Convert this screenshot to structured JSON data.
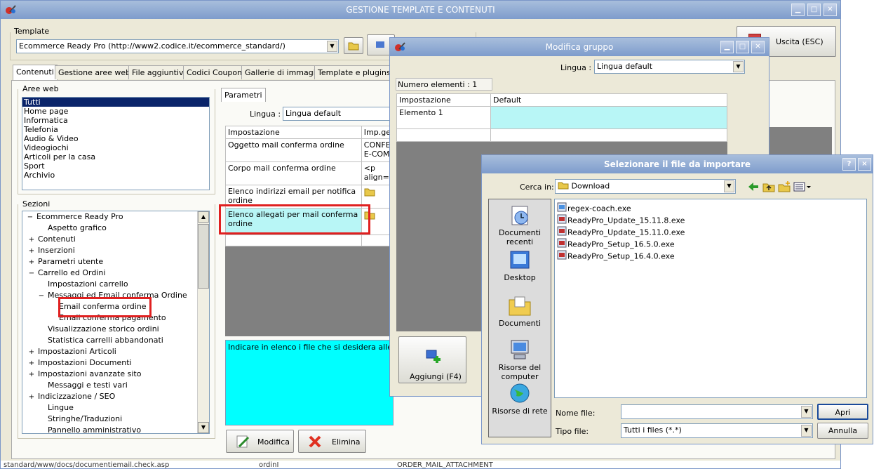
{
  "main": {
    "title": "GESTIONE TEMPLATE E CONTENUTI",
    "template_label": "Template",
    "template_value": "Ecommerce Ready Pro (http://www2.codice.it/ecommerce_standard/)",
    "exit_label": "Uscita (ESC)",
    "tabs": [
      "Contenuti",
      "Gestione aree web",
      "File aggiuntivi",
      "Codici Coupon",
      "Gallerie di immagini",
      "Template e plugins"
    ],
    "aree_web_label": "Aree web",
    "aree_web": [
      "Tutti",
      "Home page",
      "Informatica",
      "Telefonia",
      "Audio & Video",
      "Videogiochi",
      "Articoli per la casa",
      "Sport",
      "Archivio"
    ],
    "sezioni_label": "Sezioni",
    "tree": [
      {
        "exp": "−",
        "text": "Ecommerce Ready Pro"
      },
      {
        "exp": "",
        "text": "Aspetto grafico"
      },
      {
        "exp": "+",
        "text": "Contenuti"
      },
      {
        "exp": "+",
        "text": "Inserzioni"
      },
      {
        "exp": "+",
        "text": "Parametri utente"
      },
      {
        "exp": "−",
        "text": "Carrello ed Ordini"
      },
      {
        "exp": "",
        "text": "Impostazioni carrello"
      },
      {
        "exp": "−",
        "text": "Messaggi ed Email conferma Ordine"
      },
      {
        "exp": "",
        "text": "Email conferma ordine"
      },
      {
        "exp": "",
        "text": "Email conferma pagamento"
      },
      {
        "exp": "",
        "text": "Visualizzazione storico ordini"
      },
      {
        "exp": "",
        "text": "Statistica carrelli abbandonati"
      },
      {
        "exp": "+",
        "text": "Impostazioni Articoli"
      },
      {
        "exp": "+",
        "text": "Impostazioni Documenti"
      },
      {
        "exp": "+",
        "text": "Impostazioni avanzate sito"
      },
      {
        "exp": "",
        "text": "Messaggi e testi vari"
      },
      {
        "exp": "+",
        "text": "Indicizzazione / SEO"
      },
      {
        "exp": "",
        "text": "Lingue"
      },
      {
        "exp": "",
        "text": "Stringhe/Traduzioni"
      },
      {
        "exp": "",
        "text": "Pannello amministrativo"
      }
    ],
    "parametri_tab": "Parametri",
    "lingua_label": "Lingua :",
    "lingua_value": "Lingua default",
    "grid_headers": [
      "Impostazione",
      "Imp.ge"
    ],
    "grid_rows": [
      {
        "name": "Oggetto mail conferma ordine",
        "value": "CONFE E-COM"
      },
      {
        "name": "Corpo mail conferma ordine",
        "value": "<p align="
      },
      {
        "name": "Elenco indirizzi email per notifica ordine",
        "value": ""
      },
      {
        "name": "Elenco allegati per mail conferma ordine",
        "value": ""
      }
    ],
    "description": "Indicare in elenco i file che si desidera allegare al",
    "modifica_label": "Modifica",
    "elimina_label": "Elimina",
    "status_left": "​standard/www/docs/documentiemail.check.asp",
    "status_mid": "ordinI",
    "status_right": "ORDER_MAIL_ATTACHMENT"
  },
  "group_dialog": {
    "title": "Modifica gruppo",
    "lingua_label": "Lingua :",
    "lingua_value": "Lingua default",
    "count": "Numero elementi : 1",
    "headers": [
      "Impostazione",
      "Default"
    ],
    "rows": [
      "Elemento 1"
    ],
    "add_label": "Aggiungi (F4)"
  },
  "file_dialog": {
    "title": "Selezionare il file da importare",
    "look_in_label": "Cerca in:",
    "look_in_value": "Download",
    "places": [
      "Documenti recenti",
      "Desktop",
      "Documenti",
      "Risorse del computer",
      "Risorse di rete"
    ],
    "files": [
      "regex-coach.exe",
      "ReadyPro_Update_15.11.8.exe",
      "ReadyPro_Update_15.11.0.exe",
      "ReadyPro_Setup_16.5.0.exe",
      "ReadyPro_Setup_16.4.0.exe"
    ],
    "filename_label": "Nome file:",
    "filename_value": "",
    "filetype_label": "Tipo file:",
    "filetype_value": "Tutti i files (*.*)",
    "open_label": "Apri",
    "cancel_label": "Annulla",
    "help": "?",
    "close": "×"
  },
  "colors": {
    "highlight": "#b8f6f6",
    "cyan": "#00ffff",
    "selection": "#0a246a",
    "title": "#7e9ccc",
    "annotation": "#e02020"
  }
}
